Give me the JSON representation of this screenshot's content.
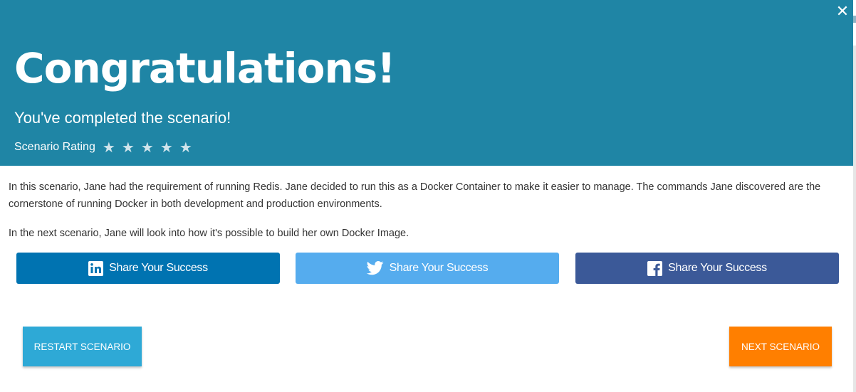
{
  "modal": {
    "close_glyph": "✕",
    "title": "Congratulations!",
    "subtitle": "You've completed the scenario!",
    "rating_label": "Scenario Rating",
    "rating_stars": [
      "★",
      "★",
      "★",
      "★",
      "★"
    ],
    "paragraphs": [
      "In this scenario, Jane had the requirement of running Redis. Jane decided to run this as a Docker Container to make it easier to manage. The commands Jane discovered are the cornerstone of running Docker in both development and production environments.",
      "In the next scenario, Jane will look into how it's possible to build her own Docker Image."
    ],
    "share_buttons": [
      {
        "network": "linkedin",
        "icon": "linkedin-icon",
        "label": "Share Your Success",
        "color": "#0073b1"
      },
      {
        "network": "twitter",
        "icon": "twitter-icon",
        "label": "Share Your Success",
        "color": "#55acee"
      },
      {
        "network": "facebook",
        "icon": "facebook-icon",
        "label": "Share Your Success",
        "color": "#3b5998"
      }
    ],
    "restart_label": "RESTART SCENARIO",
    "next_label": "NEXT SCENARIO"
  },
  "colors": {
    "header_bg": "#1f85a5",
    "restart_bg": "#2ea9d6",
    "next_bg": "#ff7f00"
  }
}
